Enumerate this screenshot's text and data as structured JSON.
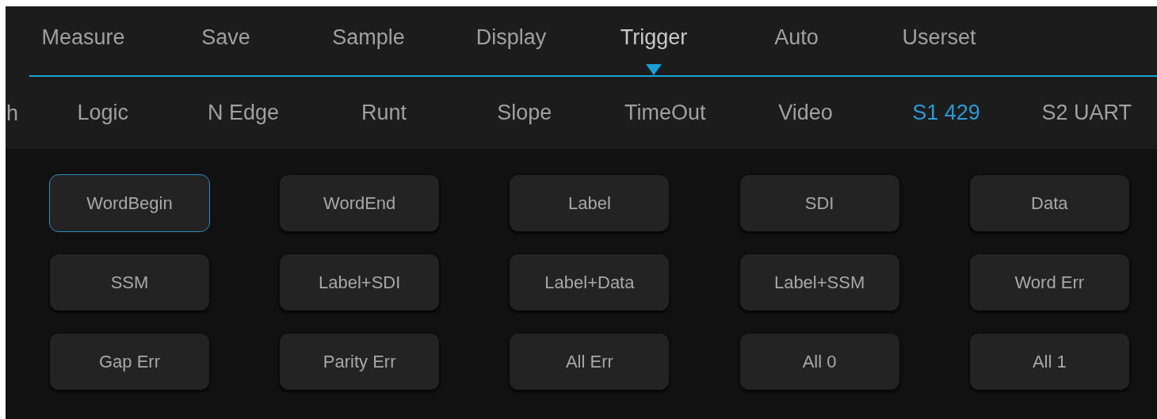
{
  "menu_tabs": [
    {
      "label": "Measure",
      "selected": false
    },
    {
      "label": "Save",
      "selected": false
    },
    {
      "label": "Sample",
      "selected": false
    },
    {
      "label": "Display",
      "selected": false
    },
    {
      "label": "Trigger",
      "selected": true
    },
    {
      "label": "Auto",
      "selected": false
    },
    {
      "label": "Userset",
      "selected": false
    }
  ],
  "trigger_tabs": [
    {
      "label": "h",
      "selected": false
    },
    {
      "label": "Logic",
      "selected": false
    },
    {
      "label": "N Edge",
      "selected": false
    },
    {
      "label": "Runt",
      "selected": false
    },
    {
      "label": "Slope",
      "selected": false
    },
    {
      "label": "TimeOut",
      "selected": false
    },
    {
      "label": "Video",
      "selected": false
    },
    {
      "label": "S1 429",
      "selected": true
    },
    {
      "label": "S2 UART",
      "selected": false
    }
  ],
  "condition_buttons": [
    {
      "label": "WordBegin",
      "selected": true
    },
    {
      "label": "WordEnd",
      "selected": false
    },
    {
      "label": "Label",
      "selected": false
    },
    {
      "label": "SDI",
      "selected": false
    },
    {
      "label": "Data",
      "selected": false
    },
    {
      "label": "SSM",
      "selected": false
    },
    {
      "label": "Label+SDI",
      "selected": false
    },
    {
      "label": "Label+Data",
      "selected": false
    },
    {
      "label": "Label+SSM",
      "selected": false
    },
    {
      "label": "Word Err",
      "selected": false
    },
    {
      "label": "Gap Err",
      "selected": false
    },
    {
      "label": "Parity Err",
      "selected": false
    },
    {
      "label": "All Err",
      "selected": false
    },
    {
      "label": "All 0",
      "selected": false
    },
    {
      "label": "All 1",
      "selected": false
    }
  ]
}
